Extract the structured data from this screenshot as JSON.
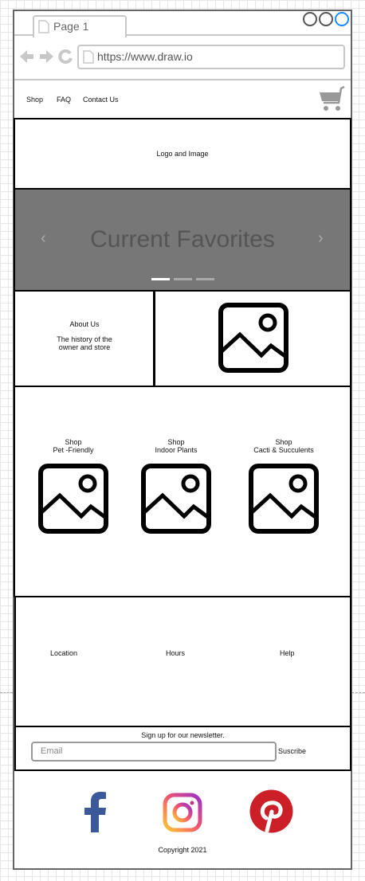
{
  "browser": {
    "tab_title": "Page 1",
    "url": "https://www.draw.io",
    "window_colors": [
      "#555555",
      "#555555",
      "#1a8cff"
    ]
  },
  "nav": {
    "items": [
      "Shop",
      "FAQ",
      "Contact Us"
    ]
  },
  "header": {
    "logo_text": "Logo and Image"
  },
  "carousel": {
    "title": "Current Favorites",
    "slide_count": 3,
    "active_slide": 1
  },
  "about": {
    "title": "About Us",
    "text_line1": "The history of the",
    "text_line2": "owner and store"
  },
  "shop": [
    {
      "line1": "Shop",
      "line2": "Pet -Friendly"
    },
    {
      "line1": "Shop",
      "line2": "Indoor Plants"
    },
    {
      "line1": "Shop",
      "line2": "Cacti & Succulents"
    }
  ],
  "footer": {
    "links": [
      "Location",
      "Hours",
      "Help"
    ],
    "newsletter_text": "Sign up for our newsletter.",
    "email_placeholder": "Email",
    "subscribe_label": "Suscribe",
    "copyright": "Copyright 2021"
  },
  "colors": {
    "facebook": "#3b5998",
    "pinterest": "#cb2027",
    "carousel_bg": "#777777"
  }
}
